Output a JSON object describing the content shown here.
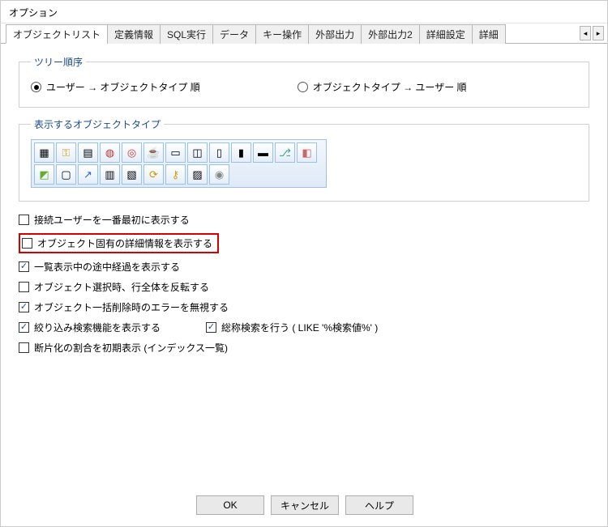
{
  "title": "オプション",
  "tabs": [
    {
      "label": "オブジェクトリスト",
      "active": true
    },
    {
      "label": "定義情報",
      "active": false
    },
    {
      "label": "SQL実行",
      "active": false
    },
    {
      "label": "データ",
      "active": false
    },
    {
      "label": "キー操作",
      "active": false
    },
    {
      "label": "外部出力",
      "active": false
    },
    {
      "label": "外部出力2",
      "active": false
    },
    {
      "label": "詳細設定",
      "active": false
    },
    {
      "label": "詳細",
      "active": false
    }
  ],
  "spin": {
    "left": "◂",
    "right": "▸"
  },
  "group1": {
    "legend": "ツリー順序",
    "radios": [
      {
        "label": "ユーザー → オブジェクトタイプ 順",
        "selected": true
      },
      {
        "label": "オブジェクトタイプ → ユーザー 順",
        "selected": false
      }
    ]
  },
  "group2": {
    "legend": "表示するオブジェクトタイプ"
  },
  "icons": [
    "grid-icon",
    "key-icon",
    "calendar-icon",
    "db1-icon",
    "db2-icon",
    "cup-icon",
    "window-icon",
    "sql-icon",
    "form-icon",
    "form2-icon",
    "form3-icon",
    "branch-icon",
    "xml-icon",
    "thumb-icon",
    "note-icon",
    "shortcut-icon",
    "table-icon",
    "sheet-icon",
    "refresh-icon",
    "key2-icon",
    "col-icon",
    "info-icon"
  ],
  "checks": [
    {
      "label": "接続ユーザーを一番最初に表示する",
      "checked": false,
      "highlight": false
    },
    {
      "label": "オブジェクト固有の詳細情報を表示する",
      "checked": false,
      "highlight": true
    },
    {
      "label": "一覧表示中の途中経過を表示する",
      "checked": true,
      "highlight": false
    },
    {
      "label": "オブジェクト選択時、行全体を反転する",
      "checked": false,
      "highlight": false
    },
    {
      "label": "オブジェクト一括削除時のエラーを無視する",
      "checked": true,
      "highlight": false
    }
  ],
  "row2": {
    "left": {
      "label": "絞り込み検索機能を表示する",
      "checked": true
    },
    "right": {
      "label": "総称検索を行う ( LIKE '%検索値%' )",
      "checked": true
    }
  },
  "lastcheck": {
    "label": "断片化の割合を初期表示 (インデックス一覧)",
    "checked": false
  },
  "buttons": {
    "ok": "OK",
    "cancel": "キャンセル",
    "help": "ヘルプ"
  }
}
